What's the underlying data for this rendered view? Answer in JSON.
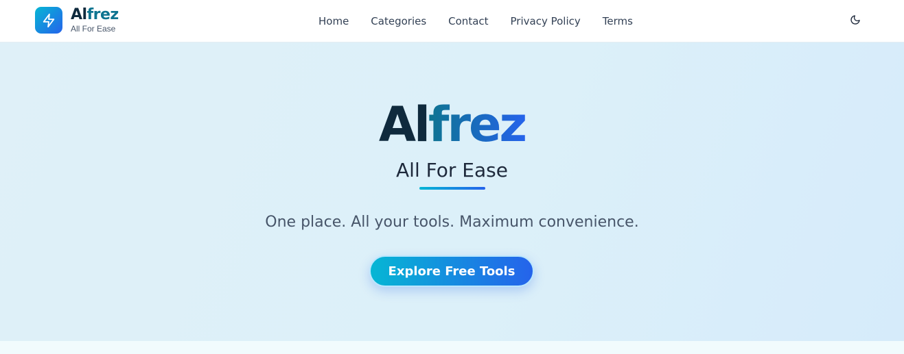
{
  "brand": {
    "name_part1": "Al",
    "name_part2": "frez",
    "tagline": "All For Ease",
    "icon": "lightning-bolt-icon"
  },
  "nav": {
    "items": [
      "Home",
      "Categories",
      "Contact",
      "Privacy Policy",
      "Terms"
    ]
  },
  "theme_toggle": {
    "icon": "moon-icon"
  },
  "hero": {
    "title_part1": "Al",
    "title_part2": "frez",
    "subtitle": "All For Ease",
    "tagline": "One place. All your tools. Maximum convenience.",
    "cta_label": "Explore Free Tools"
  },
  "colors": {
    "accent_start": "#06b6d4",
    "accent_end": "#2563eb",
    "dark_text": "#0f2a3d",
    "hero_bg": "#dcf0f9"
  }
}
